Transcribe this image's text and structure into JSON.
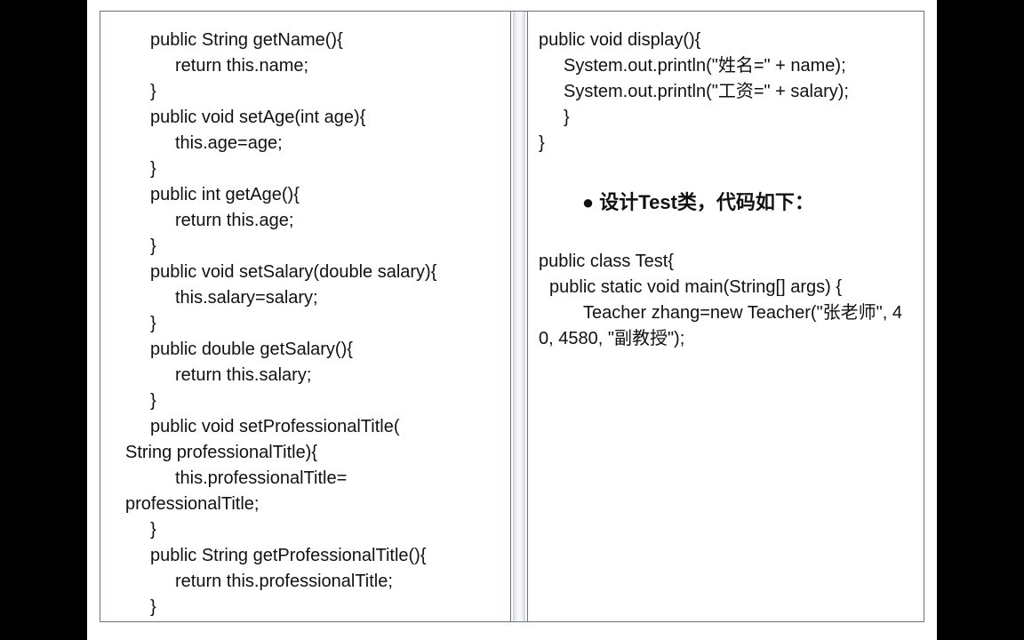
{
  "left": {
    "l1": "public String getName(){",
    "l2": "return this.name;",
    "l3": "}",
    "l4": "public void setAge(int age){",
    "l5": "this.age=age;",
    "l6": "}",
    "l7": "public int getAge(){",
    "l8": "return this.age;",
    "l9": "}",
    "l10": "public void setSalary(double salary){",
    "l11": "this.salary=salary;",
    "l12": "}",
    "l13": "public double getSalary(){",
    "l14": "return this.salary;",
    "l15": "}",
    "l16a": "public void setProfessionalTitle(",
    "l16b": "String professionalTitle){",
    "l17a": "this.professionalTitle=",
    "l17b": "professionalTitle;",
    "l18": "}",
    "l19": "public String getProfessionalTitle(){",
    "l20": "return this.professionalTitle;",
    "l21": "}"
  },
  "right": {
    "r1": "public void display(){",
    "r2": "System.out.println(\"姓名=\" + name);",
    "r3": "System.out.println(\"工资=\" + salary);",
    "r4": "}",
    "r5": "}",
    "heading": "● 设计Test类，代码如下：",
    "r6": "public class Test{",
    "r7": "public static void main(String[] args) {",
    "r8": "Teacher zhang=new Teacher(\"张老师\", 40, 4580, \"副教授\");"
  }
}
